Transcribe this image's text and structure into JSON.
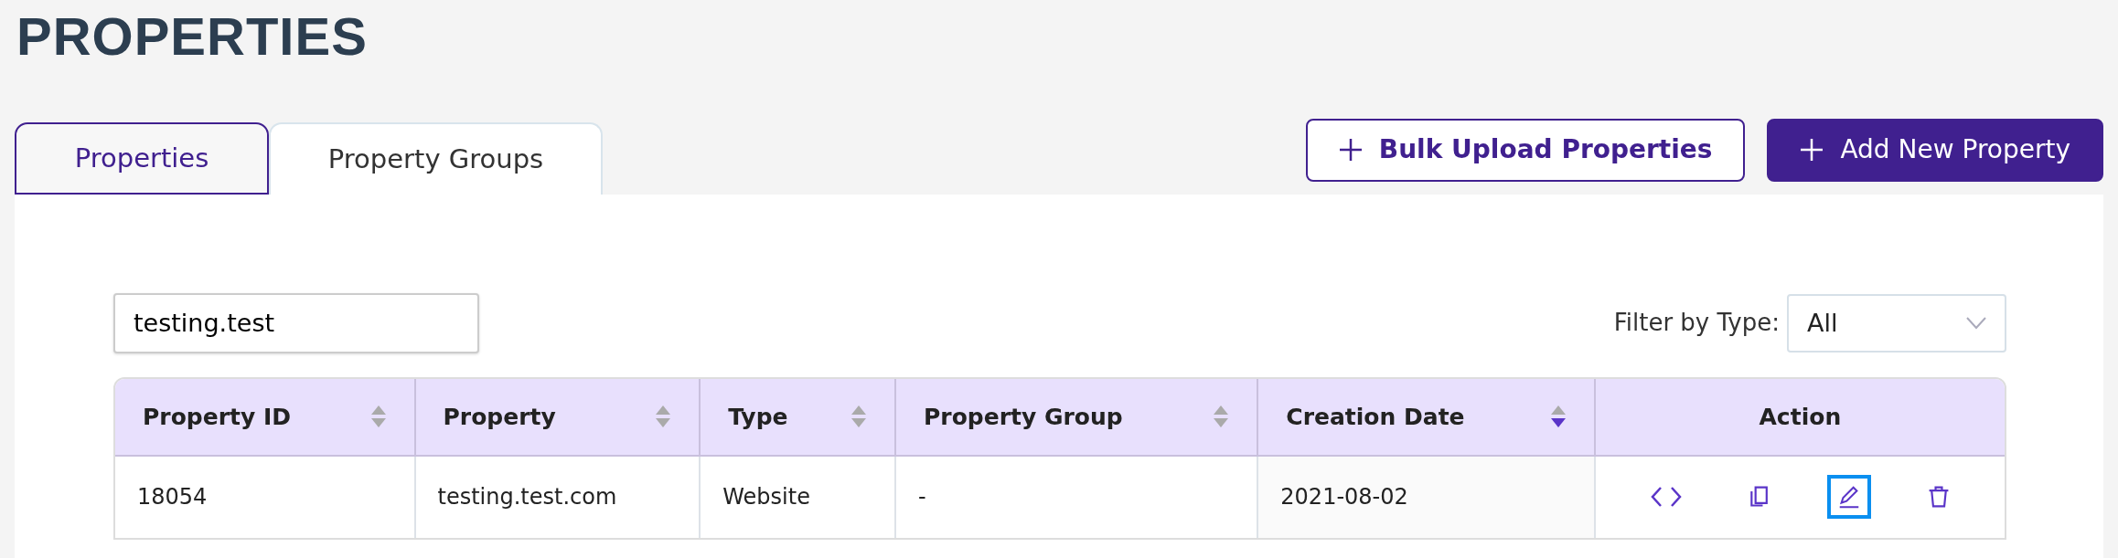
{
  "page_title": "PROPERTIES",
  "tabs": [
    {
      "label": "Properties",
      "selected": true
    },
    {
      "label": "Property Groups",
      "selected": false
    }
  ],
  "buttons": [
    {
      "label": "Bulk Upload Properties",
      "kind": "outline"
    },
    {
      "label": "Add New Property",
      "kind": "solid"
    }
  ],
  "search": {
    "value": "testing.test"
  },
  "filter": {
    "label": "Filter by Type:",
    "value": "All"
  },
  "table": {
    "columns": [
      {
        "label": "Property ID",
        "sortable": true,
        "sorted_descending": false
      },
      {
        "label": "Property",
        "sortable": true,
        "sorted_descending": false
      },
      {
        "label": "Type",
        "sortable": true,
        "sorted_descending": false
      },
      {
        "label": "Property Group",
        "sortable": true,
        "sorted_descending": false
      },
      {
        "label": "Creation Date",
        "sortable": true,
        "sorted_descending": true
      },
      {
        "label": "Action",
        "sortable": false
      }
    ],
    "rows": [
      {
        "cells": [
          "18054",
          "testing.test.com",
          "Website",
          "-",
          "2021-08-02"
        ],
        "actions": [
          {
            "kind": "code",
            "focused": false
          },
          {
            "kind": "copy",
            "focused": false
          },
          {
            "kind": "edit",
            "focused": true
          },
          {
            "kind": "delete",
            "focused": false
          }
        ]
      }
    ]
  }
}
